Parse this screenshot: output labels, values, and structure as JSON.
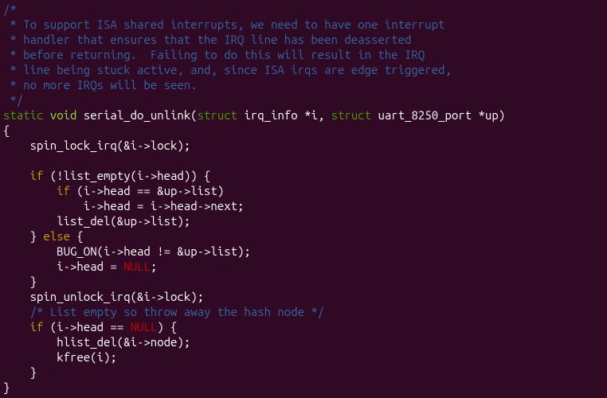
{
  "code": {
    "c1": "/*",
    "c2": " * To support ISA shared interrupts, we need to have one interrupt",
    "c3": " * handler that ensures that the IRQ line has been deasserted",
    "c4": " * before returning.  Failing to do this will result in the IRQ",
    "c5": " * line being stuck active, and, since ISA irqs are edge triggered,",
    "c6": " * no more IRQs will be seen.",
    "c7": " */",
    "kw_static": "static",
    "kw_void": "void",
    "fn_name": "serial_do_unlink",
    "kw_struct1": "struct",
    "ty_irqinfo": "irq_info",
    "param_i": "*i",
    "kw_struct2": "struct",
    "ty_uart": "uart_8250_port",
    "param_up": "*up",
    "brace_open": "{",
    "l_spinlock": "    spin_lock_irq(&i->lock);",
    "blank1": "",
    "kw_if1": "if",
    "cond1_pre": "    ",
    "cond1_open": " (",
    "cond1_txt": "!list_empty(i->head)) {",
    "kw_if2": "if",
    "cond2_pre": "        ",
    "cond2_open": " (",
    "cond2_txt": "i->head == &up->list)",
    "l_assign1": "            i->head = i->head->next;",
    "l_listdel": "        list_del(&up->list);",
    "kw_else": "else",
    "else_pre": "    } ",
    "else_post": " {",
    "l_bugon": "        BUG_ON(i->head != &up->list);",
    "l_head_pre": "        i->head = ",
    "kw_null1": "NULL",
    "l_head_post": ";",
    "l_brace_in": "    }",
    "l_spinunlock": "    spin_unlock_irq(&i->lock);",
    "c_inline": "    /* List empty so throw away the hash node */",
    "kw_if3": "if",
    "cond3_pre": "    ",
    "cond3_open": " (",
    "cond3_txt1": "i->head == ",
    "kw_null2": "NULL",
    "cond3_txt2": ") {",
    "l_hlist": "        hlist_del(&i->node);",
    "l_kfree": "        kfree(i);",
    "l_brace_in2": "    }",
    "brace_close": "}"
  }
}
